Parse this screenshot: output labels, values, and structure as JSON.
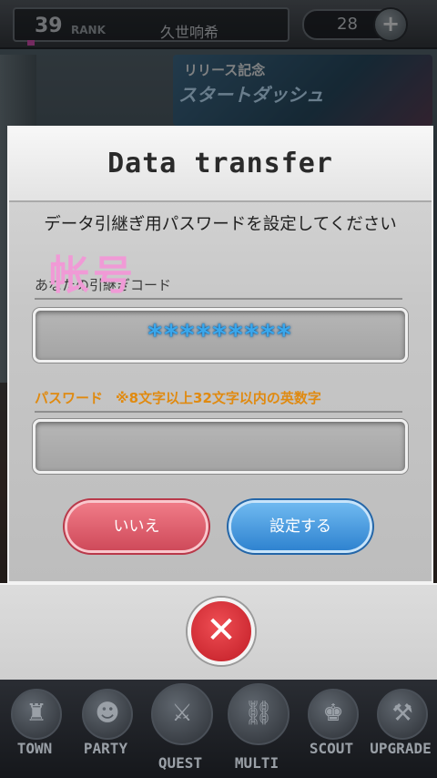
{
  "header": {
    "rank_value": "39",
    "rank_label": "RANK",
    "player_name": "久世响希",
    "currency_value": "28",
    "add_currency_symbol": "+"
  },
  "banner": {
    "subtitle": "リリース記念",
    "title": "スタートダッシュ"
  },
  "dialog": {
    "title": "Data transfer",
    "instruction": "データ引継ぎ用パスワードを設定してください",
    "code_label": "あなたの引継ぎコード",
    "code_value": "*********",
    "password_label": "パスワード",
    "password_requirement": "※8文字以上32文字以内の英数字",
    "password_value": "",
    "no_button": "いいえ",
    "set_button": "設定する",
    "close_symbol": "✕",
    "handwritten_overlay": "帐号"
  },
  "nav": [
    {
      "label": "TOWN",
      "icon": "castle-icon",
      "glyph": "♜"
    },
    {
      "label": "PARTY",
      "icon": "party-icon",
      "glyph": "☻"
    },
    {
      "label": "QUEST",
      "icon": "quest-icon",
      "glyph": "⚔"
    },
    {
      "label": "MULTI",
      "icon": "multi-icon",
      "glyph": "⛓"
    },
    {
      "label": "SCOUT",
      "icon": "scout-icon",
      "glyph": "♚"
    },
    {
      "label": "UPGRADE",
      "icon": "upgrade-icon",
      "glyph": "⚒"
    }
  ],
  "colors": {
    "password_label": "#e08a10",
    "code_value": "#3aa7ec",
    "no_button": "#cf4a5a",
    "set_button": "#2f83d0",
    "close_button": "#c01c25"
  }
}
